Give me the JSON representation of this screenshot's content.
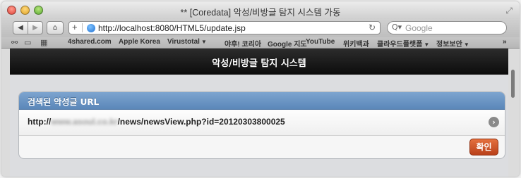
{
  "window": {
    "title": "** [Coredata] 악성/비방글 탐지 시스템 가동"
  },
  "toolbar": {
    "back_icon": "◀",
    "forward_icon": "▶",
    "home_icon": "⌂",
    "url_add": "+",
    "address": "http://localhost:8080/HTML5/update.jsp",
    "reload_icon": "↻",
    "search_icon": "Q▾",
    "search_placeholder": "Google"
  },
  "bookmarks": {
    "items": [
      {
        "label": "4shared.com",
        "has_menu": false
      },
      {
        "label": "Apple Korea",
        "has_menu": false
      },
      {
        "label": "Virustotal",
        "has_menu": true
      },
      {
        "label": "야후! 코리아",
        "has_menu": false
      },
      {
        "label": "Google 지도",
        "has_menu": false
      },
      {
        "label": "YouTube",
        "has_menu": false
      },
      {
        "label": "위키백과",
        "has_menu": false
      },
      {
        "label": "클라우드플랫폼",
        "has_menu": true
      },
      {
        "label": "정보보안",
        "has_menu": true
      }
    ],
    "overflow": "»"
  },
  "app": {
    "header_title": "악성/비방글 탐지 시스템",
    "card": {
      "header": "검색된 악성글 URL",
      "url_prefix": "http://",
      "url_blurred": "www.asoul.co.kr",
      "url_path": "/news/newsView.php?id=20120303800025",
      "chevron": "›"
    },
    "confirm_label": "확인"
  },
  "colors": {
    "card_header": "#6b95c4",
    "confirm_button": "#d35a2c",
    "app_header": "#1a1a1a"
  }
}
